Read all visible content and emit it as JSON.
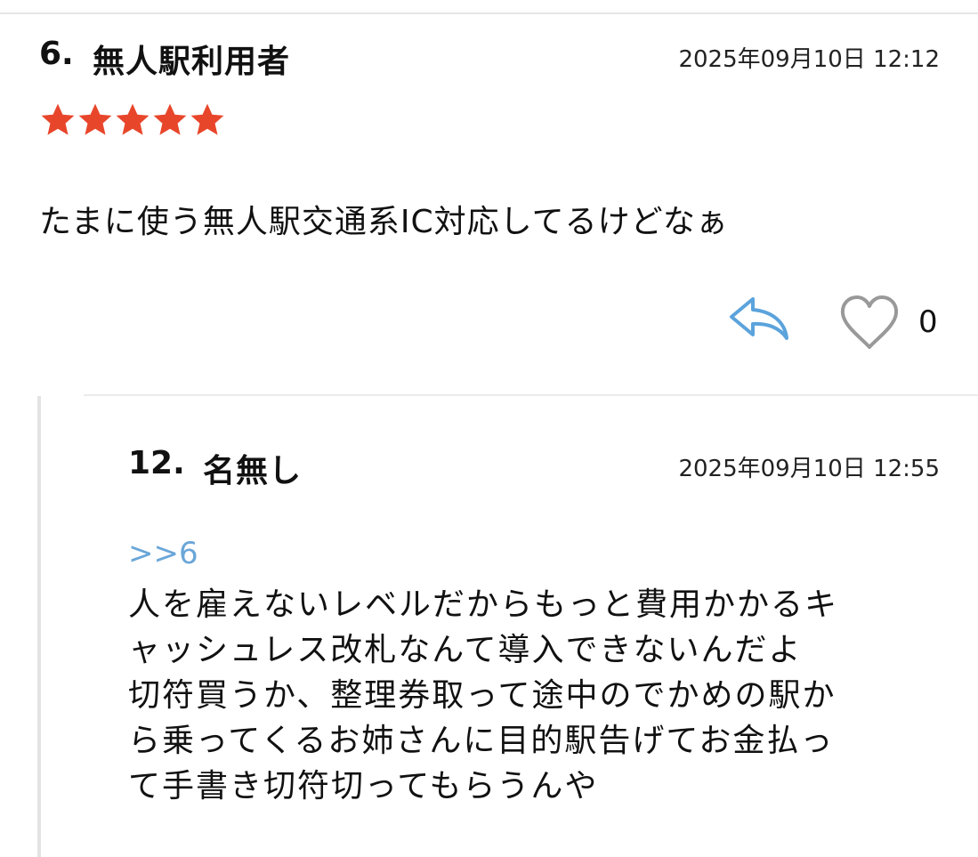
{
  "post": {
    "number": "6.",
    "name": "無人駅利用者",
    "date": "2025年09月10日 12:12",
    "rating": 5,
    "body": "たまに使う無人駅交通系IC対応してるけどなぁ",
    "like_count": "0"
  },
  "reply": {
    "number": "12.",
    "name": "名無し",
    "date": "2025年09月10日 12:55",
    "anchor": ">>6",
    "lines": [
      "人を雇えないレベルだからもっと費用かかるキ",
      "ャッシュレス改札なんて導入できないんだよ",
      "切符買うか、整理券取って途中のでかめの駅か",
      "ら乗ってくるお姉さんに目的駅告げてお金払っ",
      "て手書き切符切ってもらうんや"
    ]
  },
  "icons": {
    "star": "star-icon",
    "reply": "reply-arrow-icon",
    "like": "heart-icon"
  },
  "colors": {
    "star": "#e8462b",
    "reply_icon": "#5ba3dc",
    "heart_icon": "#999999",
    "anchor": "#6aa6d8"
  }
}
